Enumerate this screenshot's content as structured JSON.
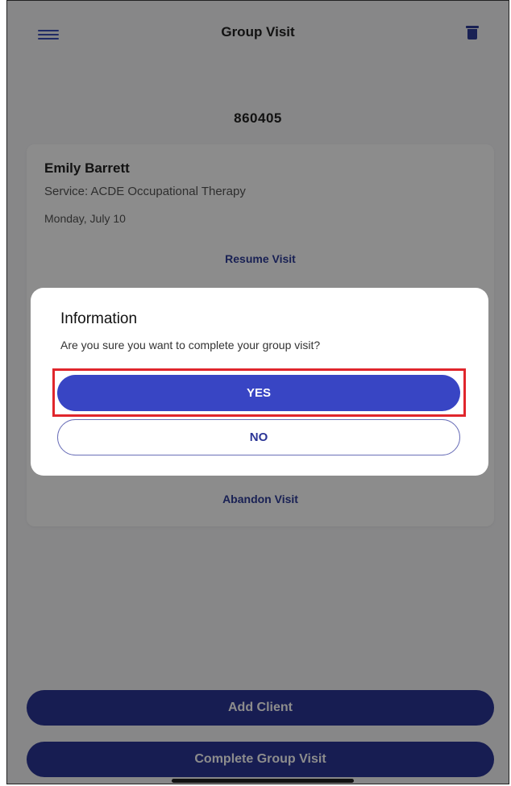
{
  "header": {
    "title": "Group Visit",
    "menu_icon": "hamburger-menu-icon",
    "delete_icon": "trash-icon"
  },
  "visit": {
    "id": "860405"
  },
  "card": {
    "client_name": "Emily Barrett",
    "service": "Service: ACDE Occupational Therapy",
    "date": "Monday, July 10",
    "resume_label": "Resume Visit",
    "abandon_label": "Abandon Visit"
  },
  "footer": {
    "add_client_label": "Add Client",
    "complete_label": "Complete Group Visit"
  },
  "dialog": {
    "title": "Information",
    "message": "Are you sure you want to complete your group visit?",
    "yes_label": "YES",
    "no_label": "NO"
  },
  "colors": {
    "primary": "#2b3596",
    "accent": "#3845c4",
    "highlight": "#e0262c"
  }
}
